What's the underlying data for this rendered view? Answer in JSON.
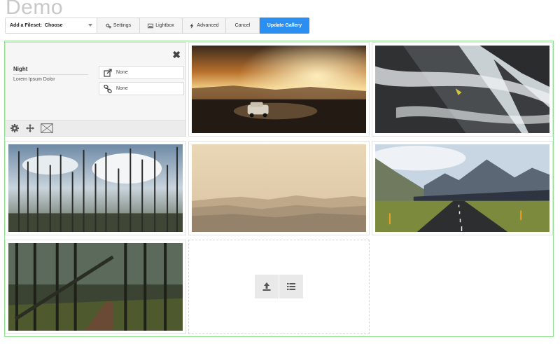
{
  "page": {
    "title": "Demo"
  },
  "toolbar": {
    "fileset_label": "Add a Fileset:",
    "fileset_value": "Choose",
    "settings_label": "Settings",
    "lightbox_label": "Lightbox",
    "advanced_label": "Advanced",
    "cancel_label": "Cancel",
    "update_label": "Update Gallery",
    "accent_color": "#2a8ff0"
  },
  "edit_panel": {
    "title": "Night",
    "description": "Lorem Ipsum Dolor",
    "link_value": "None",
    "link2_value": "None",
    "close_symbol": "✖",
    "icons": [
      "gear-icon",
      "move-icon",
      "image-placeholder-icon",
      "external-link-icon",
      "link-icon",
      "close-icon"
    ]
  },
  "gallery": {
    "images": [
      {
        "subject": "sunset-desert-car"
      },
      {
        "subject": "mountain-mist-rock"
      },
      {
        "subject": "burnt-forest-clouds"
      },
      {
        "subject": "hazy-hills"
      },
      {
        "subject": "mountain-road"
      },
      {
        "subject": "dark-forest-path"
      }
    ],
    "upload_icons": [
      "upload-icon",
      "list-icon"
    ],
    "frame_color": "#8fe08f"
  }
}
